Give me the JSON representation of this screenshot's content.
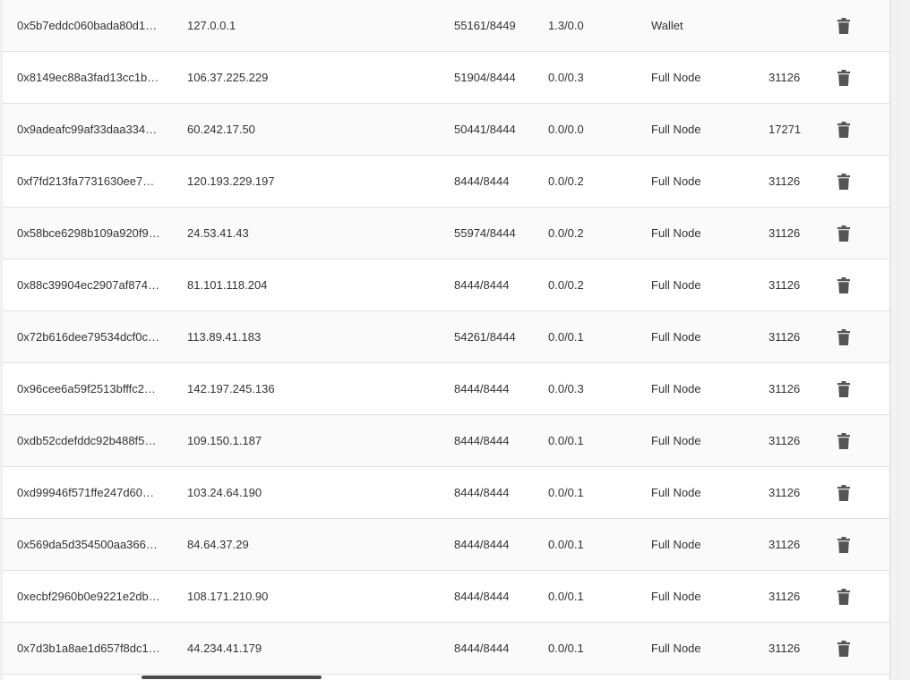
{
  "connections": [
    {
      "node_id": "0x5b7eddc060bada80d1…",
      "ip": "127.0.0.1",
      "ports": "55161/8449",
      "up_down": "1.3/0.0",
      "type": "Wallet",
      "height": ""
    },
    {
      "node_id": "0x8149ec88a3fad13cc1b…",
      "ip": "106.37.225.229",
      "ports": "51904/8444",
      "up_down": "0.0/0.3",
      "type": "Full Node",
      "height": "31126"
    },
    {
      "node_id": "0x9adeafc99af33daa334…",
      "ip": "60.242.17.50",
      "ports": "50441/8444",
      "up_down": "0.0/0.0",
      "type": "Full Node",
      "height": "17271"
    },
    {
      "node_id": "0xf7fd213fa7731630ee7…",
      "ip": "120.193.229.197",
      "ports": "8444/8444",
      "up_down": "0.0/0.2",
      "type": "Full Node",
      "height": "31126"
    },
    {
      "node_id": "0x58bce6298b109a920f9…",
      "ip": "24.53.41.43",
      "ports": "55974/8444",
      "up_down": "0.0/0.2",
      "type": "Full Node",
      "height": "31126"
    },
    {
      "node_id": "0x88c39904ec2907af874…",
      "ip": "81.101.118.204",
      "ports": "8444/8444",
      "up_down": "0.0/0.2",
      "type": "Full Node",
      "height": "31126"
    },
    {
      "node_id": "0x72b616dee79534dcf0c…",
      "ip": "113.89.41.183",
      "ports": "54261/8444",
      "up_down": "0.0/0.1",
      "type": "Full Node",
      "height": "31126"
    },
    {
      "node_id": "0x96cee6a59f2513bfffc2…",
      "ip": "142.197.245.136",
      "ports": "8444/8444",
      "up_down": "0.0/0.3",
      "type": "Full Node",
      "height": "31126"
    },
    {
      "node_id": "0xdb52cdefddc92b488f5…",
      "ip": "109.150.1.187",
      "ports": "8444/8444",
      "up_down": "0.0/0.1",
      "type": "Full Node",
      "height": "31126"
    },
    {
      "node_id": "0xd99946f571ffe247d60…",
      "ip": "103.24.64.190",
      "ports": "8444/8444",
      "up_down": "0.0/0.1",
      "type": "Full Node",
      "height": "31126"
    },
    {
      "node_id": "0x569da5d354500aa366…",
      "ip": "84.64.37.29",
      "ports": "8444/8444",
      "up_down": "0.0/0.1",
      "type": "Full Node",
      "height": "31126"
    },
    {
      "node_id": "0xecbf2960b0e9221e2db…",
      "ip": "108.171.210.90",
      "ports": "8444/8444",
      "up_down": "0.0/0.1",
      "type": "Full Node",
      "height": "31126"
    },
    {
      "node_id": "0x7d3b1a8ae1d657f8dc1…",
      "ip": "44.234.41.179",
      "ports": "8444/8444",
      "up_down": "0.0/0.1",
      "type": "Full Node",
      "height": "31126"
    }
  ],
  "icons": {
    "row_action": "delete-trash-icon"
  },
  "colors": {
    "text": "#333333",
    "icon": "#555555",
    "divider": "#e0e0e0"
  }
}
